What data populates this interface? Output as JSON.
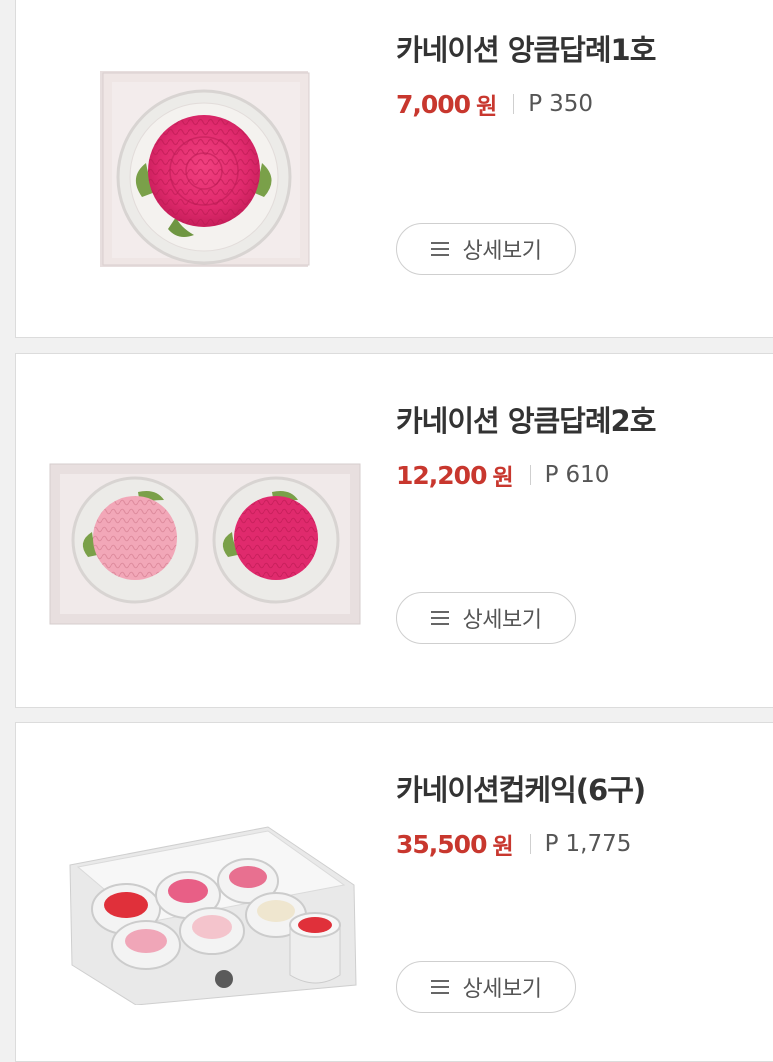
{
  "products": [
    {
      "title": "카네이션 앙큼답례1호",
      "price": "7,000",
      "currency": "원",
      "point_prefix": "P",
      "point": "350",
      "detail_label": "상세보기"
    },
    {
      "title": "카네이션 앙큼답례2호",
      "price": "12,200",
      "currency": "원",
      "point_prefix": "P",
      "point": "610",
      "detail_label": "상세보기"
    },
    {
      "title": "카네이션컵케익(6구)",
      "price": "35,500",
      "currency": "원",
      "point_prefix": "P",
      "point": "1,775",
      "detail_label": "상세보기"
    }
  ],
  "colors": {
    "price": "#c8372e",
    "title": "#333333",
    "flower_hot_pink": "#e23a78",
    "flower_light_pink": "#f1a9b8"
  },
  "icons": [
    "menu-lines-icon"
  ]
}
